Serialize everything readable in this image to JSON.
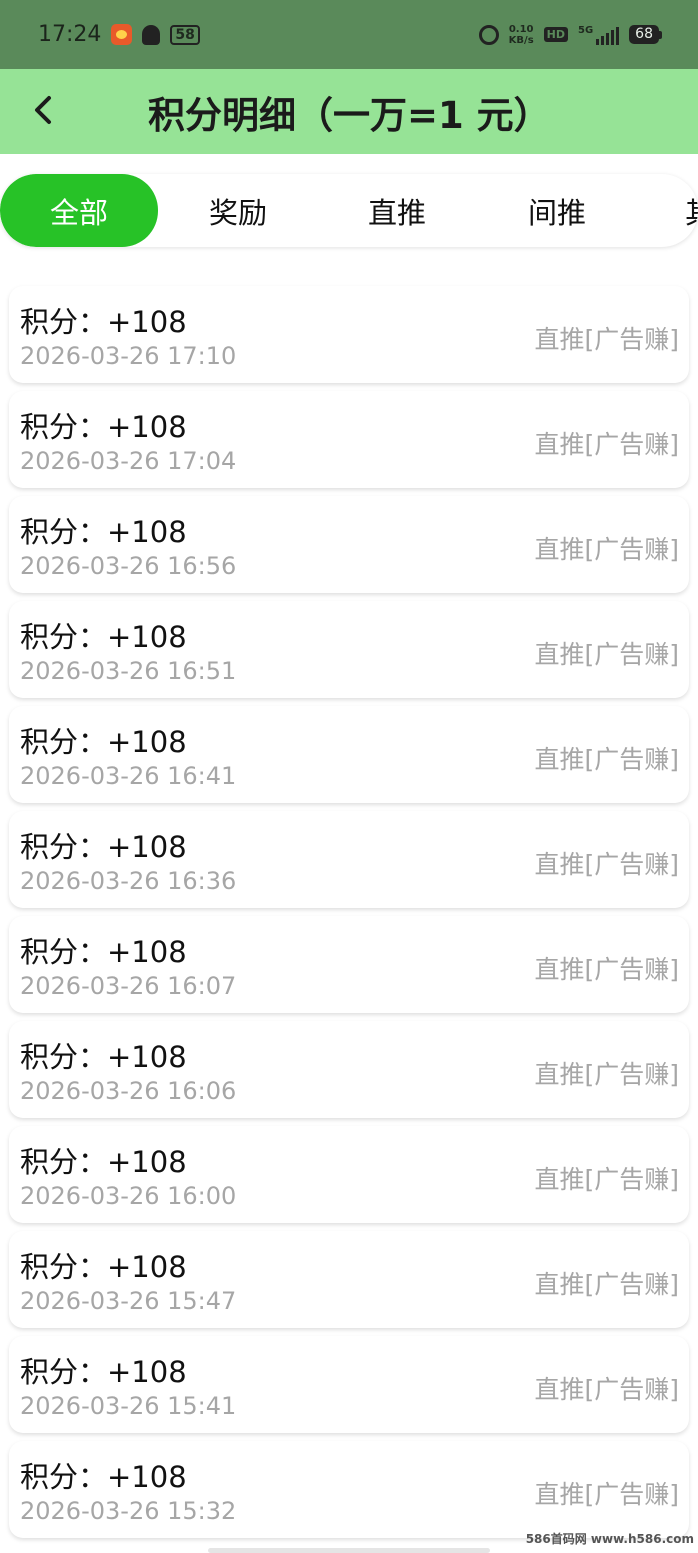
{
  "status_bar": {
    "time": "17:24",
    "notification_badge": "58",
    "net_speed_value": "0.10",
    "net_speed_unit": "KB/s",
    "hd_label": "HD",
    "network_gen": "5G",
    "battery_level": "68"
  },
  "header": {
    "title": "积分明细（一万=1 元）"
  },
  "tabs": [
    {
      "label": "全部",
      "active": true
    },
    {
      "label": "奖励",
      "active": false
    },
    {
      "label": "直推",
      "active": false
    },
    {
      "label": "间推",
      "active": false
    },
    {
      "label": "其",
      "active": false
    }
  ],
  "records": [
    {
      "points": "积分：+108",
      "time": "2026-03-26 17:10",
      "type": "直推[广告赚]"
    },
    {
      "points": "积分：+108",
      "time": "2026-03-26 17:04",
      "type": "直推[广告赚]"
    },
    {
      "points": "积分：+108",
      "time": "2026-03-26 16:56",
      "type": "直推[广告赚]"
    },
    {
      "points": "积分：+108",
      "time": "2026-03-26 16:51",
      "type": "直推[广告赚]"
    },
    {
      "points": "积分：+108",
      "time": "2026-03-26 16:41",
      "type": "直推[广告赚]"
    },
    {
      "points": "积分：+108",
      "time": "2026-03-26 16:36",
      "type": "直推[广告赚]"
    },
    {
      "points": "积分：+108",
      "time": "2026-03-26 16:07",
      "type": "直推[广告赚]"
    },
    {
      "points": "积分：+108",
      "time": "2026-03-26 16:06",
      "type": "直推[广告赚]"
    },
    {
      "points": "积分：+108",
      "time": "2026-03-26 16:00",
      "type": "直推[广告赚]"
    },
    {
      "points": "积分：+108",
      "time": "2026-03-26 15:47",
      "type": "直推[广告赚]"
    },
    {
      "points": "积分：+108",
      "time": "2026-03-26 15:41",
      "type": "直推[广告赚]"
    },
    {
      "points": "积分：+108",
      "time": "2026-03-26 15:32",
      "type": "直推[广告赚]"
    }
  ],
  "watermark": "586首码网 www.h586.com",
  "colors": {
    "status_bar": "#5a8a5a",
    "header": "#96e396",
    "active_tab": "#27c227",
    "muted_text": "#a6a6a6"
  }
}
